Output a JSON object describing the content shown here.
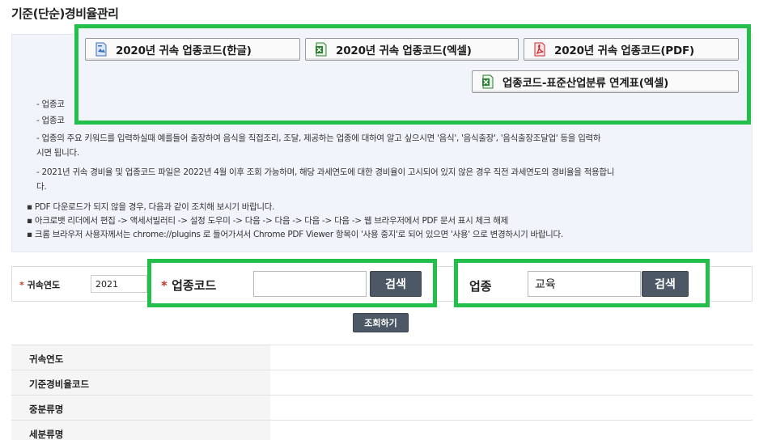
{
  "page": {
    "title": "기준(단순)경비율관리"
  },
  "downloads": [
    {
      "label": "2020년 귀속 업종코드(한글)",
      "icon": "hwp-file-icon"
    },
    {
      "label": "2020년 귀속 업종코드(엑셀)",
      "icon": "excel-file-icon"
    },
    {
      "label": "2020년 귀속 업종코드(PDF)",
      "icon": "pdf-file-icon"
    },
    {
      "label": "업종코드-표준산업분류 연계표(엑셀)",
      "icon": "excel-file-icon"
    }
  ],
  "info": {
    "line1": "- 업종코",
    "line2": "- 업종코",
    "line3a": "- 업종의 주요 키워드를 입력하실때 예를들어 출장하여 음식을 직접조리, 조달, 제공하는 업종에 대하여 알고 싶으시면 '음식', '음식출장', '음식출장조달업' 등을 입력하",
    "line3b": "시면 됩니다.",
    "line4a": "- 2021년 귀속 경비율 및 업종코드 파일은 2022년 4월 이후 조회 가능하며, 해당 과세연도에 대한 경비율이 고시되어 있지 않은 경우 직전 과세연도의 경비율을 적용합니",
    "line4b": "다.",
    "bullet1": "PDF 다운로드가 되지 않을 경우, 다음과 같이 조치해 보시기 바랍니다.",
    "bullet2": "아크로뱃 리더에서 편집 -> 액세서빌러티 -> 설정 도우미 -> 다음 -> 다음 -> 다음 -> 다음 -> 웹 브라우저에서 PDF 문서 표시 체크 해제",
    "bullet3": "크롬 브라우저 사용자께서는 chrome://plugins 로 들어가셔서 Chrome PDF Viewer 항목이 '사용 중지'로 되어 있으면 '사용' 으로 변경하시기 바랍니다."
  },
  "search": {
    "required_mark": "*",
    "year_label": "귀속연도",
    "year_value": "2021",
    "code_label": "업종코드",
    "code_value": "",
    "code_button": "검색",
    "industry_label": "업종",
    "industry_value": "교육",
    "industry_button": "검색",
    "submit_button": "조회하기"
  },
  "result_table": {
    "rows": [
      "귀속연도",
      "기준경비율코드",
      "중분류명",
      "세분류명"
    ]
  },
  "colors": {
    "highlight": "#22c04a",
    "dark_button": "#4d5866",
    "info_bg": "#f1f4fa"
  }
}
